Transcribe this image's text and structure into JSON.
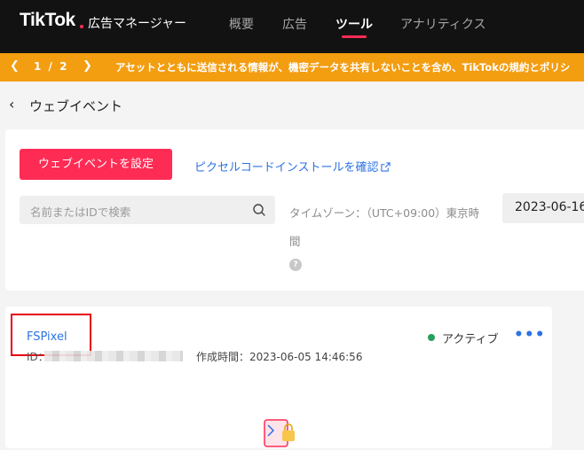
{
  "brand": {
    "name": "TikTok",
    "product": "広告マネージャー"
  },
  "nav": {
    "items": [
      {
        "label": "概要",
        "active": false
      },
      {
        "label": "広告",
        "active": false
      },
      {
        "label": "ツール",
        "active": true
      },
      {
        "label": "アナリティクス",
        "active": false
      }
    ]
  },
  "notice": {
    "pager": "1 / 2",
    "message": "アセットとともに送信される情報が、機密データを共有しないことを含め、TikTokの規約とポリシ"
  },
  "page": {
    "title": "ウェブイベント"
  },
  "toolbar": {
    "primary_button": "ウェブイベントを設定",
    "install_link": "ピクセルコードインストールを確認",
    "search_placeholder": "名前またはIDで検索",
    "timezone_label": "タイムゾーン：（UTC+09:00）東京時間",
    "date_value": "2023-06-16"
  },
  "pixel": {
    "name": "FSPixel",
    "id_label": "ID：",
    "created_label": "作成時間：2023-06-05 14:46:56",
    "status": "アクティブ",
    "more": "•••"
  },
  "colors": {
    "accent": "#fe2c55",
    "link": "#2c73e4",
    "notice": "#f39d11",
    "status_active": "#26a05b",
    "highlight": "#e60012"
  }
}
